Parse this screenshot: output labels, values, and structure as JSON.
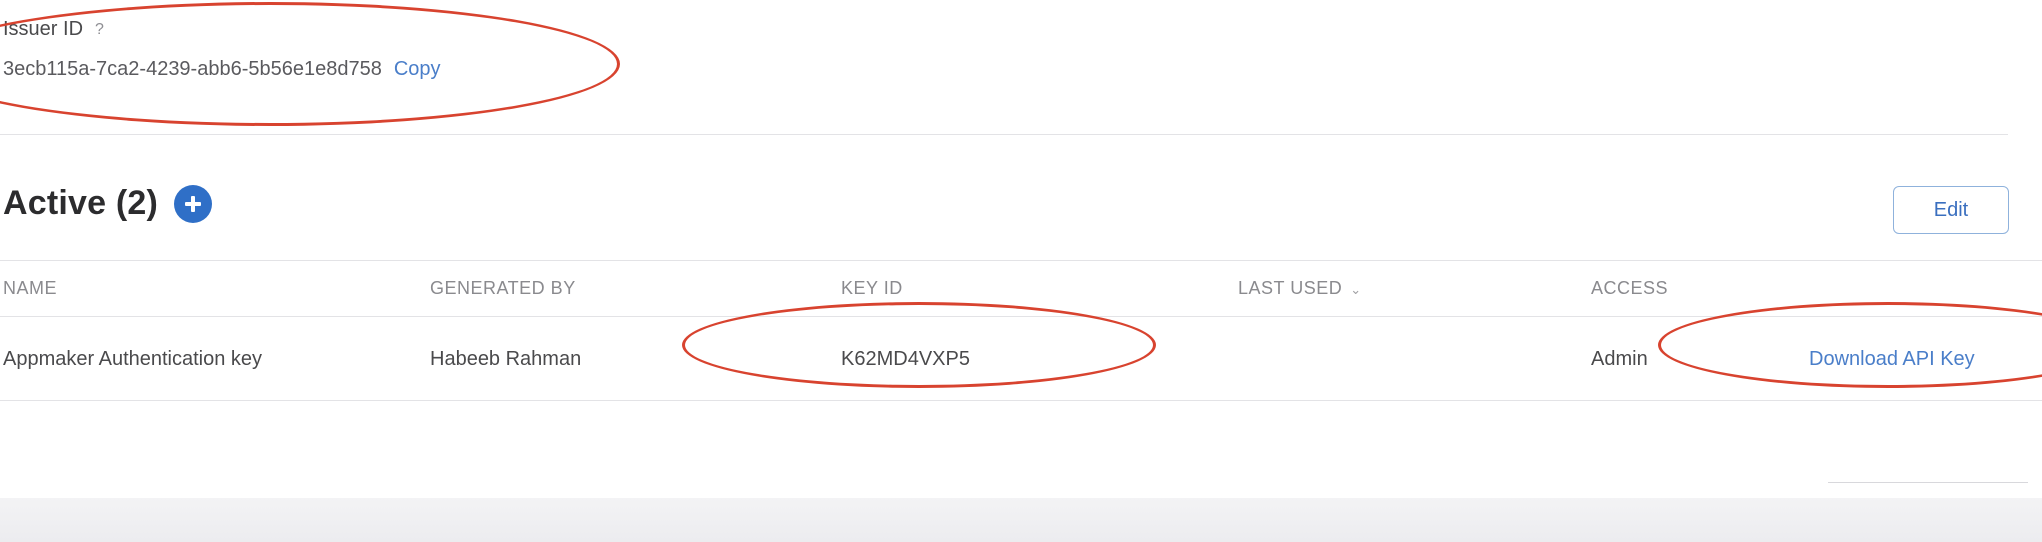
{
  "issuer": {
    "label": "Issuer ID",
    "help": "?",
    "value": "3ecb115a-7ca2-4239-abb6-5b56e1e8d758",
    "copy_label": "Copy"
  },
  "section": {
    "title": "Active (2)",
    "add_icon": "plus-circle-icon",
    "edit_label": "Edit"
  },
  "table": {
    "columns": [
      "NAME",
      "GENERATED BY",
      "KEY ID",
      "LAST USED",
      "ACCESS"
    ],
    "sort_icon": "chevron-down-icon",
    "rows": [
      {
        "name": "Appmaker Authentication key",
        "generated_by": "Habeeb Rahman",
        "key_id": "K62MD4VXP5",
        "last_used": "",
        "access": "Admin",
        "action": "Download API Key"
      }
    ]
  },
  "colors": {
    "accent": "#2f6fc7",
    "link": "#4a7ec9",
    "annotation": "#d8432f"
  }
}
